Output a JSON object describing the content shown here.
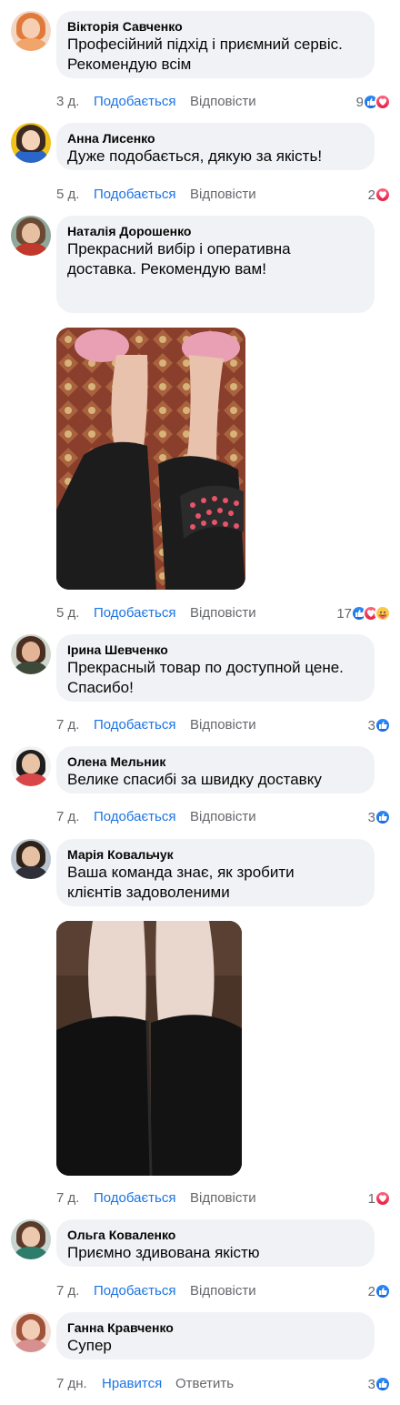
{
  "labels": {
    "like": "Подобається",
    "reply": "Відповісти"
  },
  "comments": [
    {
      "author": "Вікторія Савченко",
      "text": "Професійний підхід і приємний сервіс.\nРекомендую всім",
      "time": "3 д.",
      "reaction_count": "9",
      "reactions": [
        "like-icon",
        "love-icon"
      ]
    },
    {
      "author": "Анна Лисенко",
      "text": "Дуже подобається, дякую за якість!",
      "time": "5 д.",
      "reaction_count": "2",
      "reactions": [
        "love-icon"
      ]
    },
    {
      "author": "Наталія Дорошенко",
      "text": "Прекрасний вибір і оперативна\nдоставка. Рекомендую вам!",
      "time": "5 д.",
      "reaction_count": "17",
      "reactions": [
        "like-icon",
        "love-icon",
        "care-icon"
      ]
    },
    {
      "author": "Ірина Шевченко",
      "text": "Прекрасный товар по доступной цене.\nСпасибо!",
      "time": "7 д.",
      "reaction_count": "3",
      "reactions": [
        "like-icon"
      ]
    },
    {
      "author": "Олена Мельник",
      "text": "Велике спасибі за швидку доставку",
      "time": "7 д.",
      "reaction_count": "3",
      "reactions": [
        "like-icon"
      ]
    },
    {
      "author": "Марія Ковальчук",
      "text": "Ваша команда знає, як зробити\nклієнтів задоволеними",
      "time": "7 д.",
      "reaction_count": "1",
      "reactions": [
        "love-icon"
      ]
    },
    {
      "author": "Ольга Коваленко",
      "text": "Приємно здивована якістю",
      "time": "7 д.",
      "reaction_count": "2",
      "reactions": [
        "like-icon"
      ]
    },
    {
      "author": "Ганна Кравченко",
      "text": "Супер",
      "time": "7 дн.",
      "like_label": "Нравится",
      "reply_label": "Ответить",
      "reaction_count": "3",
      "reactions": [
        "like-icon"
      ]
    }
  ]
}
